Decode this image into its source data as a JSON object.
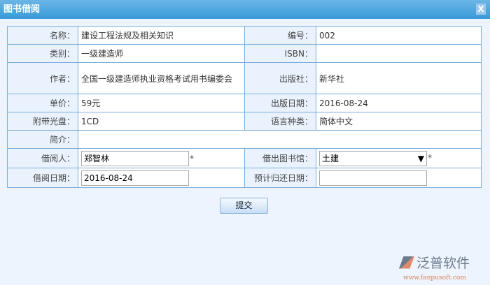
{
  "window": {
    "title": "图书借阅",
    "close_label": "X"
  },
  "form": {
    "name_label": "名称：",
    "name": "建设工程法规及相关知识",
    "code_label": "编号：",
    "code": "002",
    "category_label": "类别：",
    "category": "一级建造师",
    "isbn_label": "ISBN：",
    "isbn": "",
    "author_label": "作者：",
    "author": "全国一级建造师执业资格考试用书编委会",
    "publisher_label": "出版社：",
    "publisher": "新华社",
    "price_label": "单价：",
    "price": "59元",
    "pub_date_label": "出版日期：",
    "pub_date": "2016-08-24",
    "disc_label": "附带光盘：",
    "disc": "1CD",
    "language_label": "语言种类：",
    "language": "简体中文",
    "intro_label": "简介：",
    "intro": "",
    "borrower_label": "借阅人：",
    "borrower": "郑智林",
    "library_label": "借出图书馆：",
    "library": "土建",
    "borrow_date_label": "借阅日期：",
    "borrow_date": "2016-08-24",
    "return_date_label": "预计归还日期：",
    "return_date": "",
    "required_mark": "*"
  },
  "submit_label": "提交",
  "logo": {
    "name": "泛普软件",
    "url": "www.fanpusoft.com"
  }
}
